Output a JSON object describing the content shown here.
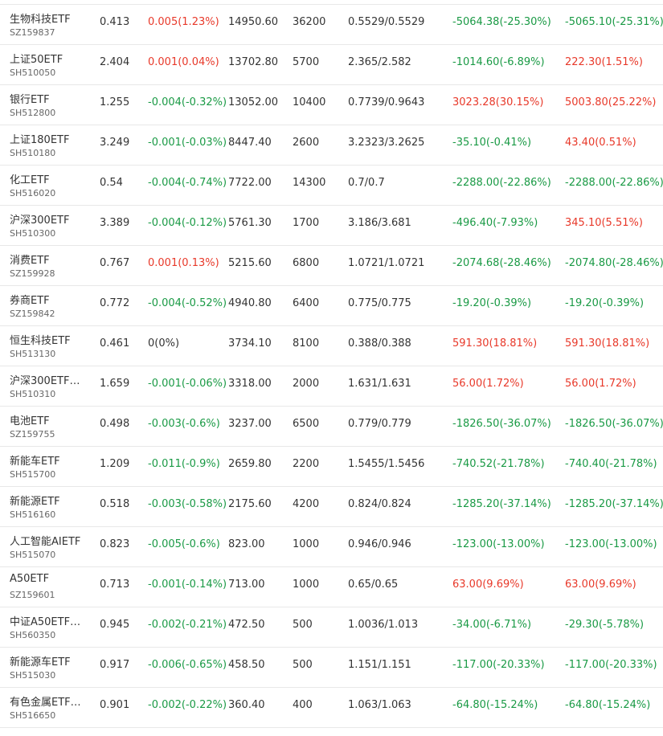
{
  "colors": {
    "up": "#e8392a",
    "down": "#1a9a45",
    "flat": "#333333"
  },
  "rows": [
    {
      "name": "生物科技ETF",
      "code": "SZ159837",
      "price": "0.413",
      "change": "0.005(1.23%)",
      "change_dir": "up",
      "market_value": "14950.60",
      "quantity": "36200",
      "cost": "0.5529/0.5529",
      "pnl": "-5064.38(-25.30%)",
      "pnl_dir": "down",
      "total_pnl": "-5065.10(-25.31%)",
      "total_dir": "down"
    },
    {
      "name": "上证50ETF",
      "code": "SH510050",
      "price": "2.404",
      "change": "0.001(0.04%)",
      "change_dir": "up",
      "market_value": "13702.80",
      "quantity": "5700",
      "cost": "2.365/2.582",
      "pnl": "-1014.60(-6.89%)",
      "pnl_dir": "down",
      "total_pnl": "222.30(1.51%)",
      "total_dir": "up"
    },
    {
      "name": "银行ETF",
      "code": "SH512800",
      "price": "1.255",
      "change": "-0.004(-0.32%)",
      "change_dir": "down",
      "market_value": "13052.00",
      "quantity": "10400",
      "cost": "0.7739/0.9643",
      "pnl": "3023.28(30.15%)",
      "pnl_dir": "up",
      "total_pnl": "5003.80(25.22%)",
      "total_dir": "up"
    },
    {
      "name": "上证180ETF",
      "code": "SH510180",
      "price": "3.249",
      "change": "-0.001(-0.03%)",
      "change_dir": "down",
      "market_value": "8447.40",
      "quantity": "2600",
      "cost": "3.2323/3.2625",
      "pnl": "-35.10(-0.41%)",
      "pnl_dir": "down",
      "total_pnl": "43.40(0.51%)",
      "total_dir": "up"
    },
    {
      "name": "化工ETF",
      "code": "SH516020",
      "price": "0.54",
      "change": "-0.004(-0.74%)",
      "change_dir": "down",
      "market_value": "7722.00",
      "quantity": "14300",
      "cost": "0.7/0.7",
      "pnl": "-2288.00(-22.86%)",
      "pnl_dir": "down",
      "total_pnl": "-2288.00(-22.86%)",
      "total_dir": "down"
    },
    {
      "name": "沪深300ETF",
      "code": "SH510300",
      "price": "3.389",
      "change": "-0.004(-0.12%)",
      "change_dir": "down",
      "market_value": "5761.30",
      "quantity": "1700",
      "cost": "3.186/3.681",
      "pnl": "-496.40(-7.93%)",
      "pnl_dir": "down",
      "total_pnl": "345.10(5.51%)",
      "total_dir": "up"
    },
    {
      "name": "消费ETF",
      "code": "SZ159928",
      "price": "0.767",
      "change": "0.001(0.13%)",
      "change_dir": "up",
      "market_value": "5215.60",
      "quantity": "6800",
      "cost": "1.0721/1.0721",
      "pnl": "-2074.68(-28.46%)",
      "pnl_dir": "down",
      "total_pnl": "-2074.80(-28.46%)",
      "total_dir": "down"
    },
    {
      "name": "券商ETF",
      "code": "SZ159842",
      "price": "0.772",
      "change": "-0.004(-0.52%)",
      "change_dir": "down",
      "market_value": "4940.80",
      "quantity": "6400",
      "cost": "0.775/0.775",
      "pnl": "-19.20(-0.39%)",
      "pnl_dir": "down",
      "total_pnl": "-19.20(-0.39%)",
      "total_dir": "down"
    },
    {
      "name": "恒生科技ETF",
      "code": "SH513130",
      "price": "0.461",
      "change": "0(0%)",
      "change_dir": "flat",
      "market_value": "3734.10",
      "quantity": "8100",
      "cost": "0.388/0.388",
      "pnl": "591.30(18.81%)",
      "pnl_dir": "up",
      "total_pnl": "591.30(18.81%)",
      "total_dir": "up"
    },
    {
      "name": "沪深300ETF…",
      "code": "SH510310",
      "price": "1.659",
      "change": "-0.001(-0.06%)",
      "change_dir": "down",
      "market_value": "3318.00",
      "quantity": "2000",
      "cost": "1.631/1.631",
      "pnl": "56.00(1.72%)",
      "pnl_dir": "up",
      "total_pnl": "56.00(1.72%)",
      "total_dir": "up"
    },
    {
      "name": "电池ETF",
      "code": "SZ159755",
      "price": "0.498",
      "change": "-0.003(-0.6%)",
      "change_dir": "down",
      "market_value": "3237.00",
      "quantity": "6500",
      "cost": "0.779/0.779",
      "pnl": "-1826.50(-36.07%)",
      "pnl_dir": "down",
      "total_pnl": "-1826.50(-36.07%)",
      "total_dir": "down"
    },
    {
      "name": "新能车ETF",
      "code": "SH515700",
      "price": "1.209",
      "change": "-0.011(-0.9%)",
      "change_dir": "down",
      "market_value": "2659.80",
      "quantity": "2200",
      "cost": "1.5455/1.5456",
      "pnl": "-740.52(-21.78%)",
      "pnl_dir": "down",
      "total_pnl": "-740.40(-21.78%)",
      "total_dir": "down"
    },
    {
      "name": "新能源ETF",
      "code": "SH516160",
      "price": "0.518",
      "change": "-0.003(-0.58%)",
      "change_dir": "down",
      "market_value": "2175.60",
      "quantity": "4200",
      "cost": "0.824/0.824",
      "pnl": "-1285.20(-37.14%)",
      "pnl_dir": "down",
      "total_pnl": "-1285.20(-37.14%)",
      "total_dir": "down"
    },
    {
      "name": "人工智能AIETF",
      "code": "SH515070",
      "price": "0.823",
      "change": "-0.005(-0.6%)",
      "change_dir": "down",
      "market_value": "823.00",
      "quantity": "1000",
      "cost": "0.946/0.946",
      "pnl": "-123.00(-13.00%)",
      "pnl_dir": "down",
      "total_pnl": "-123.00(-13.00%)",
      "total_dir": "down"
    },
    {
      "name": "A50ETF",
      "code": "SZ159601",
      "price": "0.713",
      "change": "-0.001(-0.14%)",
      "change_dir": "down",
      "market_value": "713.00",
      "quantity": "1000",
      "cost": "0.65/0.65",
      "pnl": "63.00(9.69%)",
      "pnl_dir": "up",
      "total_pnl": "63.00(9.69%)",
      "total_dir": "up"
    },
    {
      "name": "中证A50ETF…",
      "code": "SH560350",
      "price": "0.945",
      "change": "-0.002(-0.21%)",
      "change_dir": "down",
      "market_value": "472.50",
      "quantity": "500",
      "cost": "1.0036/1.013",
      "pnl": "-34.00(-6.71%)",
      "pnl_dir": "down",
      "total_pnl": "-29.30(-5.78%)",
      "total_dir": "down"
    },
    {
      "name": "新能源车ETF",
      "code": "SH515030",
      "price": "0.917",
      "change": "-0.006(-0.65%)",
      "change_dir": "down",
      "market_value": "458.50",
      "quantity": "500",
      "cost": "1.151/1.151",
      "pnl": "-117.00(-20.33%)",
      "pnl_dir": "down",
      "total_pnl": "-117.00(-20.33%)",
      "total_dir": "down"
    },
    {
      "name": "有色金属ETF…",
      "code": "SH516650",
      "price": "0.901",
      "change": "-0.002(-0.22%)",
      "change_dir": "down",
      "market_value": "360.40",
      "quantity": "400",
      "cost": "1.063/1.063",
      "pnl": "-64.80(-15.24%)",
      "pnl_dir": "down",
      "total_pnl": "-64.80(-15.24%)",
      "total_dir": "down"
    }
  ]
}
